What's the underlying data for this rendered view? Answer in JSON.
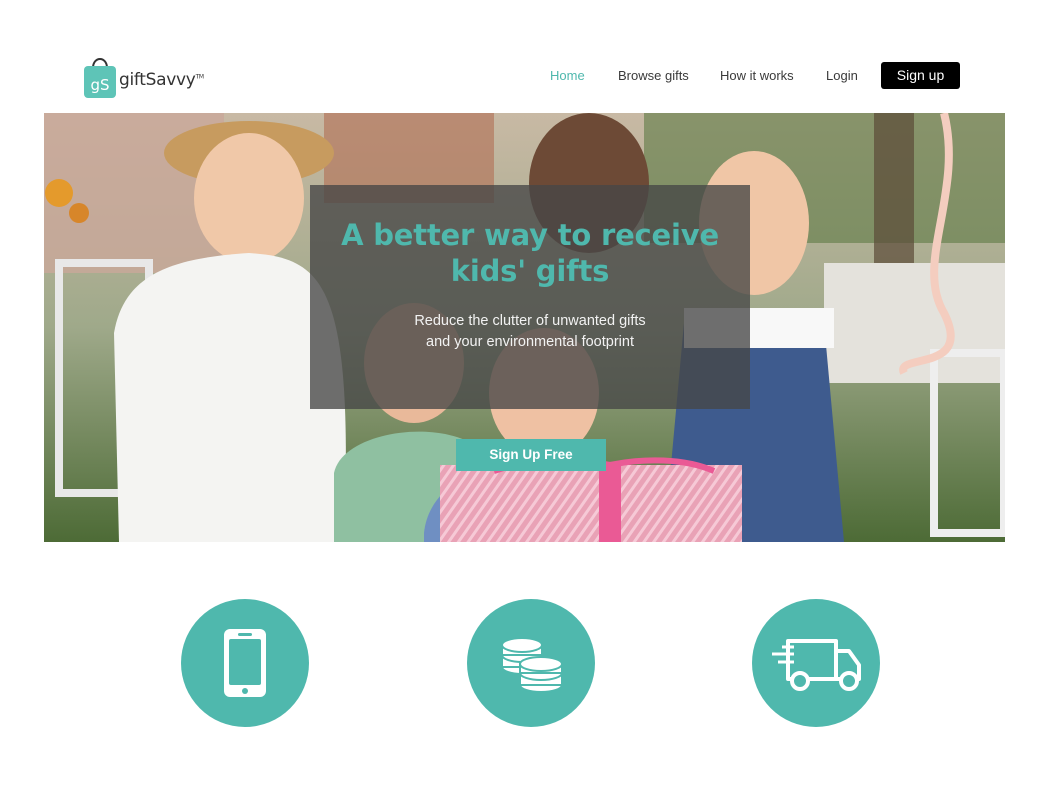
{
  "brand": {
    "logo_monogram": "gS",
    "name": "giftSavvy",
    "tm": "TM",
    "accent_color": "#4fb8ad"
  },
  "nav": {
    "items": [
      {
        "label": "Home",
        "active": true
      },
      {
        "label": "Browse gifts",
        "active": false
      },
      {
        "label": "How it works",
        "active": false
      },
      {
        "label": "Login",
        "active": false
      }
    ],
    "signup_label": "Sign up"
  },
  "hero": {
    "title_line1": "A better way to receive",
    "title_line2": "kids' gifts",
    "subtitle_line1": "Reduce the clutter of unwanted gifts",
    "subtitle_line2": "and your environmental footprint",
    "cta_label": "Sign Up Free"
  },
  "features": [
    {
      "icon": "smartphone-icon"
    },
    {
      "icon": "coins-icon"
    },
    {
      "icon": "delivery-truck-icon"
    }
  ]
}
